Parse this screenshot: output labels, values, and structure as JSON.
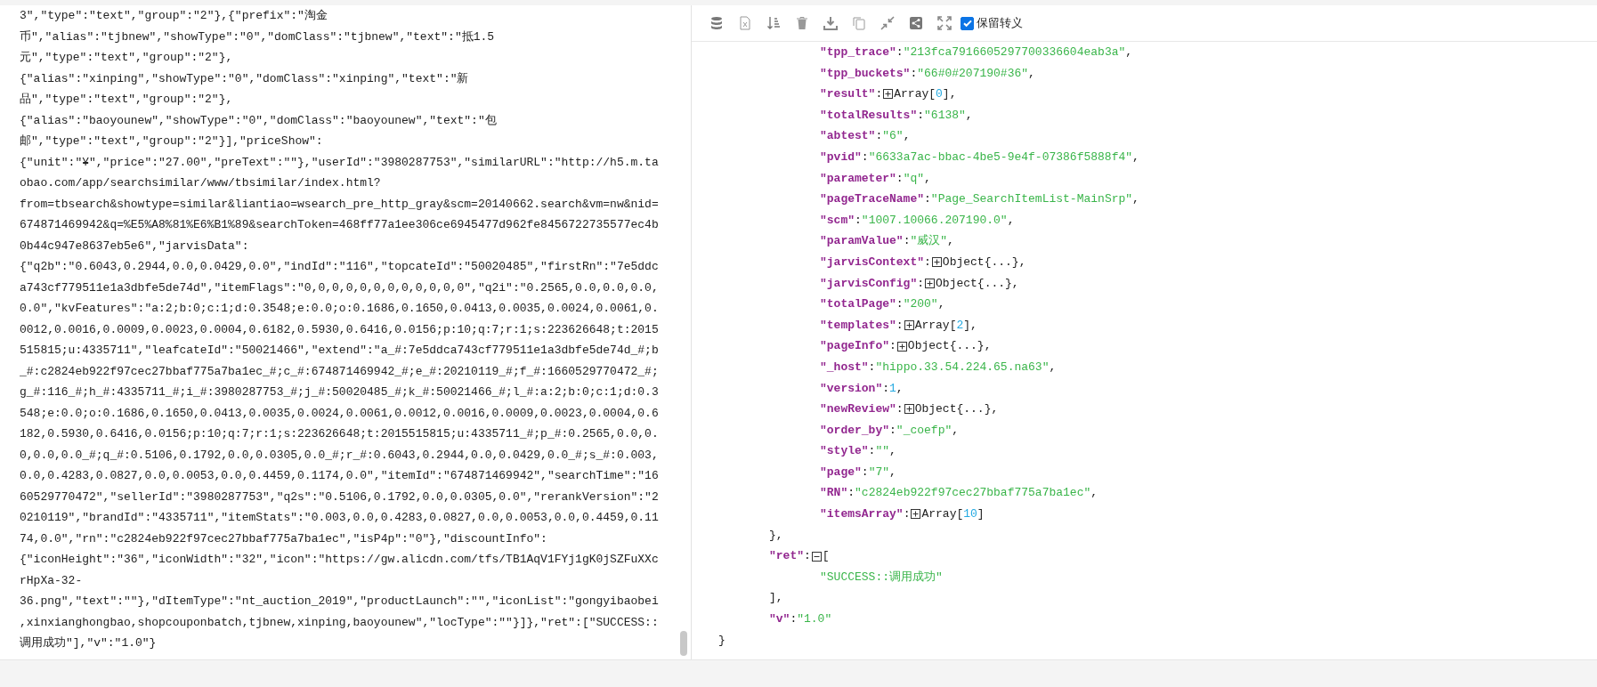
{
  "left_panel": {
    "lines": [
      "3\",\"type\":\"text\",\"group\":\"2\"},{\"prefix\":\"淘金",
      "币\",\"alias\":\"tjbnew\",\"showType\":\"0\",\"domClass\":\"tjbnew\",\"text\":\"抵1.5",
      "元\",\"type\":\"text\",\"group\":\"2\"},",
      "{\"alias\":\"xinping\",\"showType\":\"0\",\"domClass\":\"xinping\",\"text\":\"新",
      "品\",\"type\":\"text\",\"group\":\"2\"},",
      "{\"alias\":\"baoyounew\",\"showType\":\"0\",\"domClass\":\"baoyounew\",\"text\":\"包",
      "邮\",\"type\":\"text\",\"group\":\"2\"}],\"priceShow\":",
      "{\"unit\":\"¥\",\"price\":\"27.00\",\"preText\":\"\"},\"userId\":\"3980287753\",\"similarURL\":\"http://h5.m.ta",
      "obao.com/app/searchsimilar/www/tbsimilar/index.html?",
      "from=tbsearch&showtype=similar&liantiao=wsearch_pre_http_gray&scm=20140662.search&vm=nw&nid=",
      "674871469942&q=%E5%A8%81%E6%B1%89&searchToken=468ff77a1ee306ce6945477d962fe8456722735577ec4b",
      "0b44c947e8637eb5e6\",\"jarvisData\":",
      "{\"q2b\":\"0.6043,0.2944,0.0,0.0429,0.0\",\"indId\":\"116\",\"topcateId\":\"50020485\",\"firstRn\":\"7e5ddc",
      "a743cf779511e1a3dbfe5de74d\",\"itemFlags\":\"0,0,0,0,0,0,0,0,0,0,0,0\",\"q2i\":\"0.2565,0.0,0.0,0.0,",
      "0.0\",\"kvFeatures\":\"a:2;b:0;c:1;d:0.3548;e:0.0;o:0.1686,0.1650,0.0413,0.0035,0.0024,0.0061,0.",
      "0012,0.0016,0.0009,0.0023,0.0004,0.6182,0.5930,0.6416,0.0156;p:10;q:7;r:1;s:223626648;t:2015",
      "515815;u:4335711\",\"leafcateId\":\"50021466\",\"extend\":\"a_#:7e5ddca743cf779511e1a3dbfe5de74d_#;b",
      "_#:c2824eb922f97cec27bbaf775a7ba1ec_#;c_#:674871469942_#;e_#:20210119_#;f_#:1660529770472_#;",
      "g_#:116_#;h_#:4335711_#;i_#:3980287753_#;j_#:50020485_#;k_#:50021466_#;l_#:a:2;b:0;c:1;d:0.3",
      "548;e:0.0;o:0.1686,0.1650,0.0413,0.0035,0.0024,0.0061,0.0012,0.0016,0.0009,0.0023,0.0004,0.6",
      "182,0.5930,0.6416,0.0156;p:10;q:7;r:1;s:223626648;t:2015515815;u:4335711_#;p_#:0.2565,0.0,0.",
      "0,0.0,0.0_#;q_#:0.5106,0.1792,0.0,0.0305,0.0_#;r_#:0.6043,0.2944,0.0,0.0429,0.0_#;s_#:0.003,",
      "0.0,0.4283,0.0827,0.0,0.0053,0.0,0.4459,0.1174,0.0\",\"itemId\":\"674871469942\",\"searchTime\":\"16",
      "60529770472\",\"sellerId\":\"3980287753\",\"q2s\":\"0.5106,0.1792,0.0,0.0305,0.0\",\"rerankVersion\":\"2",
      "0210119\",\"brandId\":\"4335711\",\"itemStats\":\"0.003,0.0,0.4283,0.0827,0.0,0.0053,0.0,0.4459,0.11",
      "74,0.0\",\"rn\":\"c2824eb922f97cec27bbaf775a7ba1ec\",\"isP4p\":\"0\"},\"discountInfo\":",
      "{\"iconHeight\":\"36\",\"iconWidth\":\"32\",\"icon\":\"https://gw.alicdn.com/tfs/TB1AqV1FYj1gK0jSZFuXXc",
      "rHpXa-32-",
      "36.png\",\"text\":\"\"},\"dItemType\":\"nt_auction_2019\",\"productLaunch\":\"\",\"iconList\":\"gongyibaobei",
      ",xinxianghongbao,shopcouponbatch,tjbnew,xinping,baoyounew\",\"locType\":\"\"}]},\"ret\":[\"SUCCESS::",
      "调用成功\"],\"v\":\"1.0\"}"
    ]
  },
  "toolbar": {
    "checkbox": {
      "label": "保留转义",
      "checked": true
    }
  },
  "tree": {
    "close": "}",
    "children": [
      {
        "close": "},",
        "children": [
          {
            "key": "\"tpp_trace\"",
            "sep": ":",
            "kind": "string",
            "value": "\"213fca7916605297700336604eab3a\"",
            "end": ","
          },
          {
            "key": "\"tpp_buckets\"",
            "sep": ":",
            "kind": "string",
            "value": "\"66#0#207190#36\"",
            "end": ","
          },
          {
            "key": "\"result\"",
            "sep": ":",
            "kind": "collapsed",
            "expanded": false,
            "label": "Array[",
            "count": "0",
            "end": "],"
          },
          {
            "key": "\"totalResults\"",
            "sep": ":",
            "kind": "string",
            "value": "\"6138\"",
            "end": ","
          },
          {
            "key": "\"abtest\"",
            "sep": ":",
            "kind": "string",
            "value": "\"6\"",
            "end": ","
          },
          {
            "key": "\"pvid\"",
            "sep": ":",
            "kind": "string",
            "value": "\"6633a7ac-bbac-4be5-9e4f-07386f5888f4\"",
            "end": ","
          },
          {
            "key": "\"parameter\"",
            "sep": ":",
            "kind": "string",
            "value": "\"q\"",
            "end": ","
          },
          {
            "key": "\"pageTraceName\"",
            "sep": ":",
            "kind": "string",
            "value": "\"Page_SearchItemList-MainSrp\"",
            "end": ","
          },
          {
            "key": "\"scm\"",
            "sep": ":",
            "kind": "string",
            "value": "\"1007.10066.207190.0\"",
            "end": ","
          },
          {
            "key": "\"paramValue\"",
            "sep": ":",
            "kind": "string",
            "value": "\"威汉\"",
            "end": ","
          },
          {
            "key": "\"jarvisContext\"",
            "sep": ":",
            "kind": "collapsed",
            "expanded": false,
            "label": "Object{...}",
            "end": ","
          },
          {
            "key": "\"jarvisConfig\"",
            "sep": ":",
            "kind": "collapsed",
            "expanded": false,
            "label": "Object{...}",
            "end": ","
          },
          {
            "key": "\"totalPage\"",
            "sep": ":",
            "kind": "string",
            "value": "\"200\"",
            "end": ","
          },
          {
            "key": "\"templates\"",
            "sep": ":",
            "kind": "collapsed",
            "expanded": false,
            "label": "Array[",
            "count": "2",
            "end": "],"
          },
          {
            "key": "\"pageInfo\"",
            "sep": ":",
            "kind": "collapsed",
            "expanded": false,
            "label": "Object{...}",
            "end": ","
          },
          {
            "key": "\"_host\"",
            "sep": ":",
            "kind": "string",
            "value": "\"hippo.33.54.224.65.na63\"",
            "end": ","
          },
          {
            "key": "\"version\"",
            "sep": ":",
            "kind": "number",
            "value": "1",
            "end": ","
          },
          {
            "key": "\"newReview\"",
            "sep": ":",
            "kind": "collapsed",
            "expanded": false,
            "label": "Object{...}",
            "end": ","
          },
          {
            "key": "\"order_by\"",
            "sep": ":",
            "kind": "string",
            "value": "\"_coefp\"",
            "end": ","
          },
          {
            "key": "\"style\"",
            "sep": ":",
            "kind": "string",
            "value": "\"\"",
            "end": ","
          },
          {
            "key": "\"page\"",
            "sep": ":",
            "kind": "string",
            "value": "\"7\"",
            "end": ","
          },
          {
            "key": "\"RN\"",
            "sep": ":",
            "kind": "string",
            "value": "\"c2824eb922f97cec27bbaf775a7ba1ec\"",
            "end": ","
          },
          {
            "key": "\"itemsArray\"",
            "sep": ":",
            "kind": "collapsed",
            "expanded": false,
            "label": "Array[",
            "count": "10",
            "end": "]"
          }
        ]
      },
      {
        "key": "\"ret\"",
        "sep": ":",
        "kind": "array",
        "expanded": true,
        "label": "[",
        "close": "],",
        "children": [
          {
            "kind": "string",
            "value": "\"SUCCESS::调用成功\""
          }
        ]
      },
      {
        "key": "\"v\"",
        "sep": ":",
        "kind": "string",
        "value": "\"1.0\""
      }
    ]
  }
}
